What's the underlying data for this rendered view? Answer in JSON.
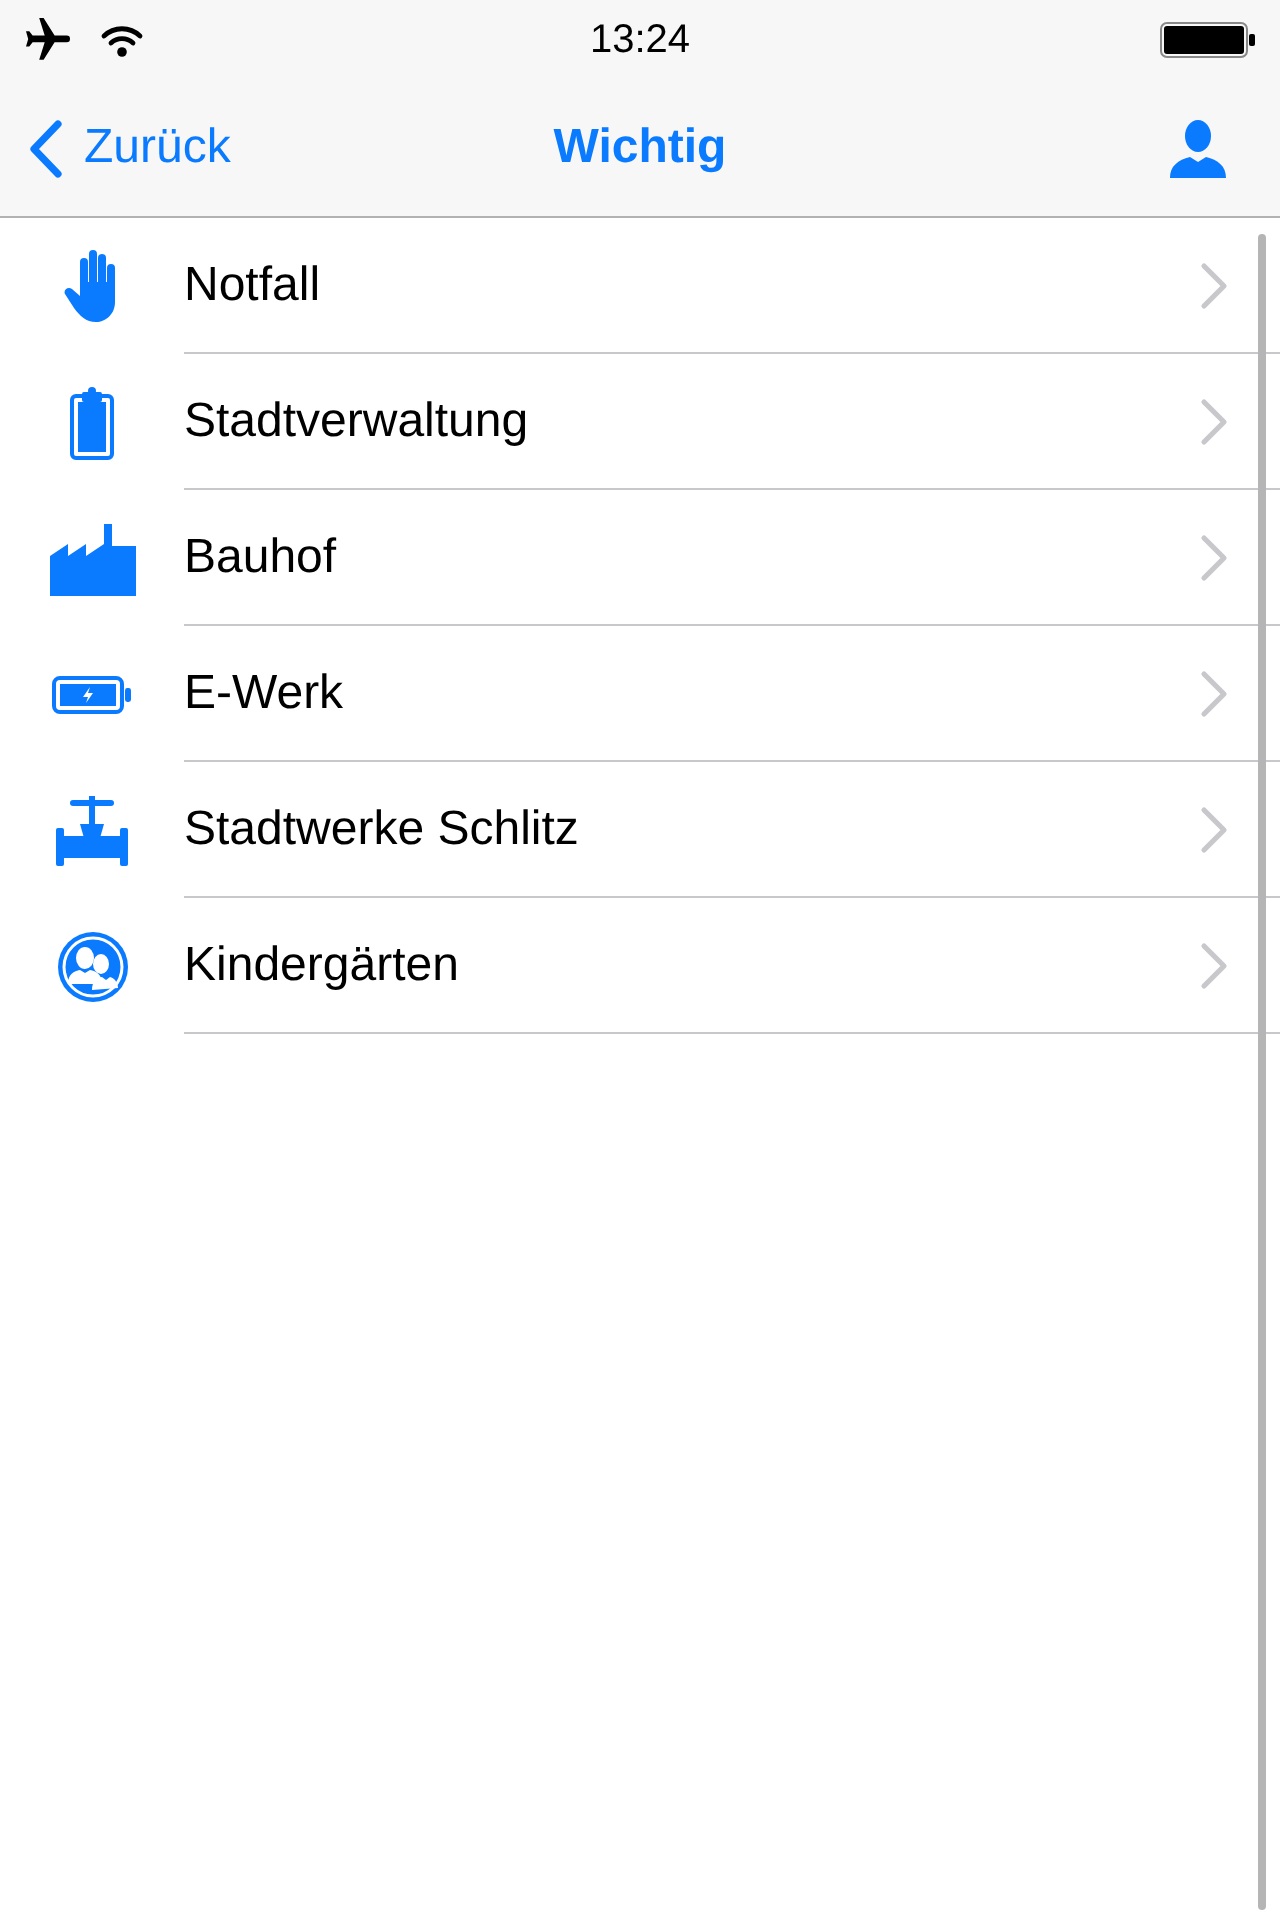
{
  "status_bar": {
    "time": "13:24"
  },
  "nav_bar": {
    "back": "Zurück",
    "title": "Wichtig"
  },
  "list": {
    "items": [
      {
        "label": "Notfall"
      },
      {
        "label": "Stadtverwaltung"
      },
      {
        "label": "Bauhof"
      },
      {
        "label": "E-Werk"
      },
      {
        "label": "Stadtwerke Schlitz"
      },
      {
        "label": "Kindergärten"
      }
    ]
  }
}
